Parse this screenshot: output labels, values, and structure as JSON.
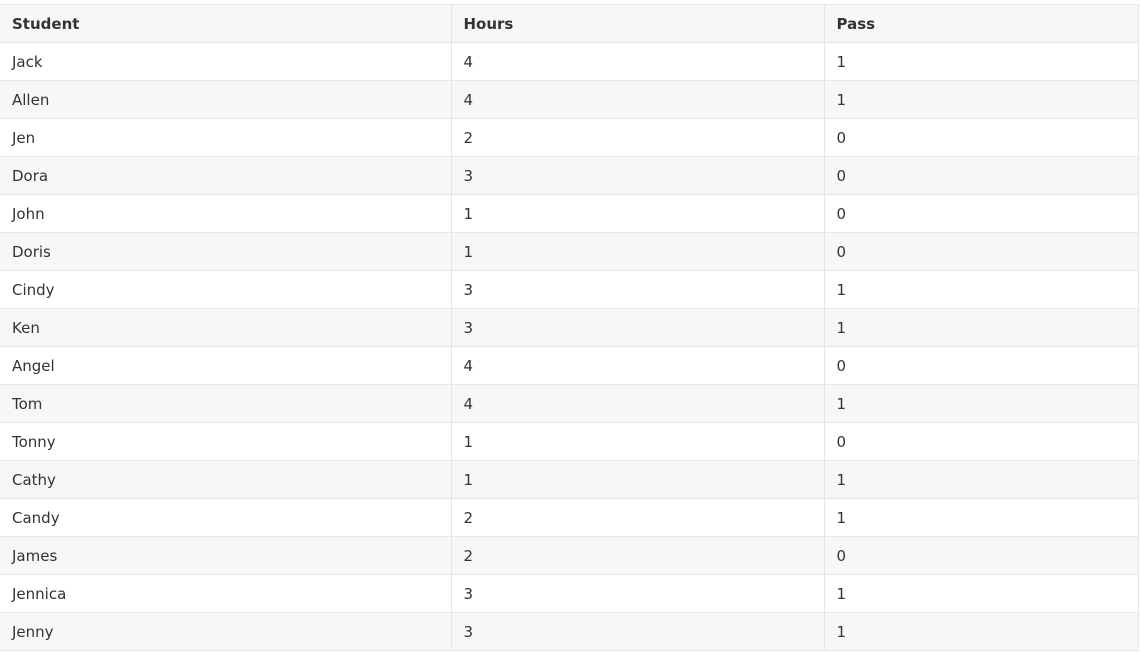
{
  "table": {
    "headers": [
      "Student",
      "Hours",
      "Pass"
    ],
    "rows": [
      [
        "Jack",
        "4",
        "1"
      ],
      [
        "Allen",
        "4",
        "1"
      ],
      [
        "Jen",
        "2",
        "0"
      ],
      [
        "Dora",
        "3",
        "0"
      ],
      [
        "John",
        "1",
        "0"
      ],
      [
        "Doris",
        "1",
        "0"
      ],
      [
        "Cindy",
        "3",
        "1"
      ],
      [
        "Ken",
        "3",
        "1"
      ],
      [
        "Angel",
        "4",
        "0"
      ],
      [
        "Tom",
        "4",
        "1"
      ],
      [
        "Tonny",
        "1",
        "0"
      ],
      [
        "Cathy",
        "1",
        "1"
      ],
      [
        "Candy",
        "2",
        "1"
      ],
      [
        "James",
        "2",
        "0"
      ],
      [
        "Jennica",
        "3",
        "1"
      ],
      [
        "Jenny",
        "3",
        "1"
      ]
    ]
  },
  "colors": {
    "header_bg": "#f7f7f7",
    "stripe_bg": "#f7f7f7",
    "border": "#e6e6e6",
    "text": "#333333"
  }
}
